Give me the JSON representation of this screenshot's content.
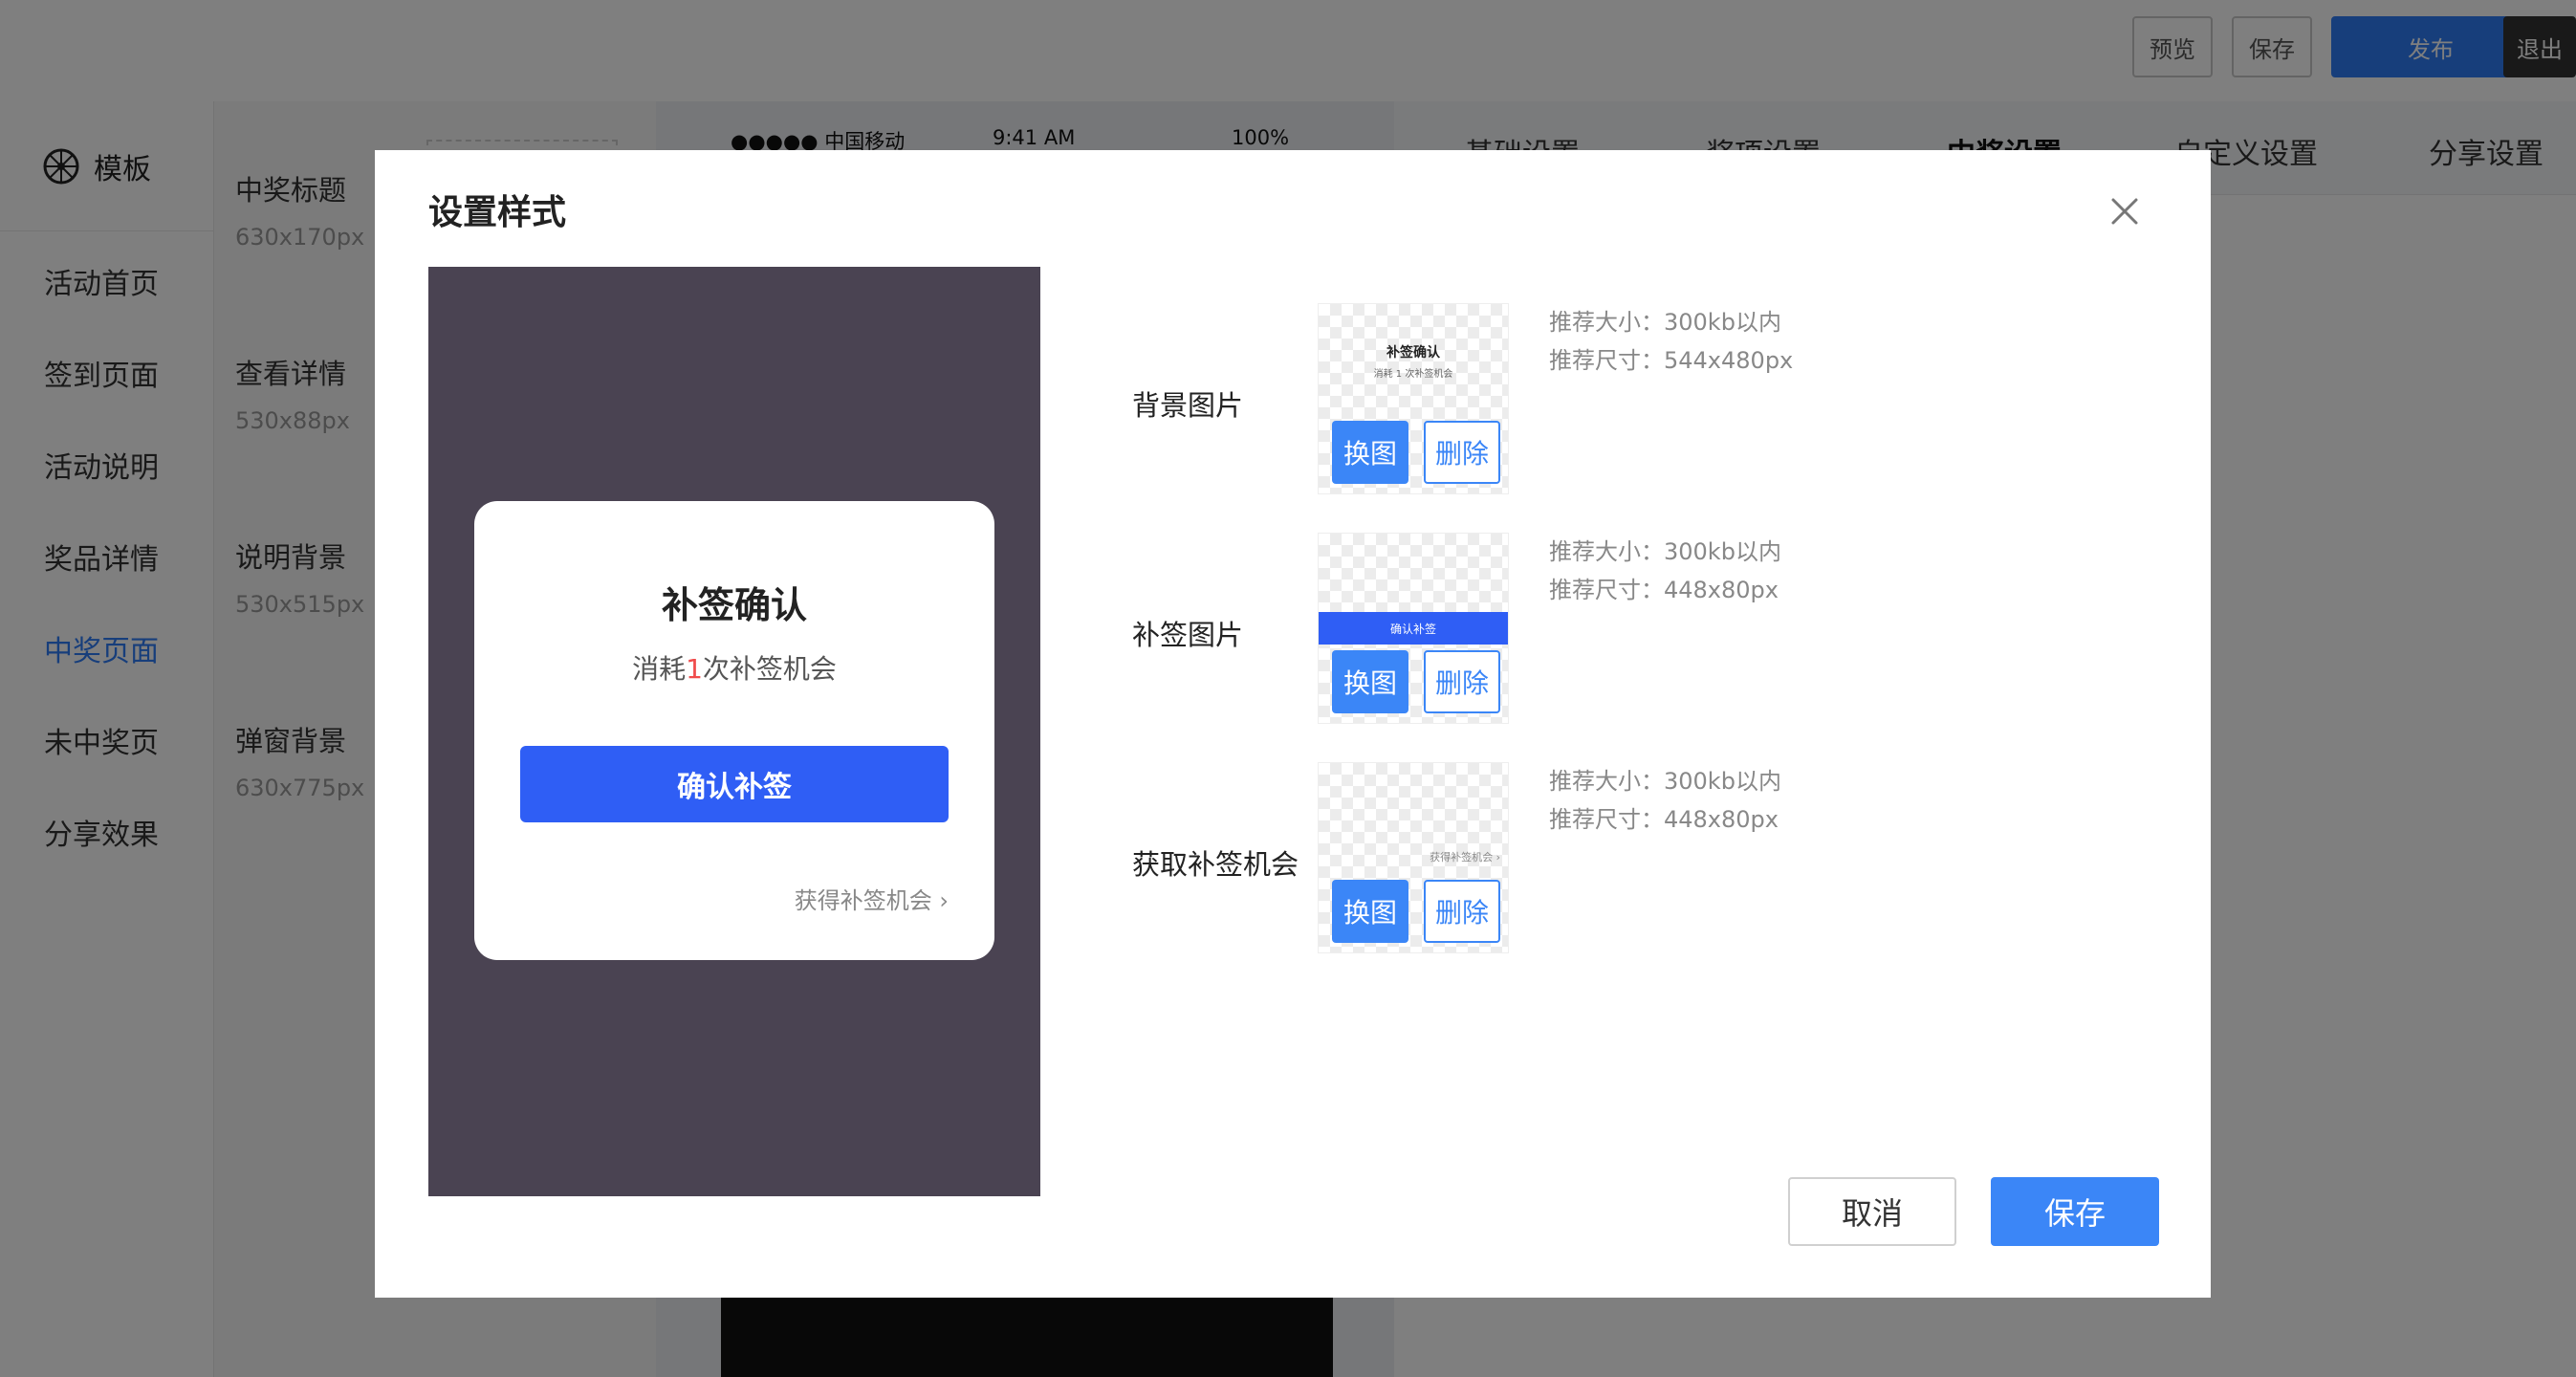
{
  "topbar": {
    "preview_label": "预览",
    "save_label": "保存",
    "publish_label": "发布",
    "exit_label": "退出"
  },
  "sidebar": {
    "header": "模板",
    "items": [
      {
        "label": "活动首页"
      },
      {
        "label": "签到页面"
      },
      {
        "label": "活动说明"
      },
      {
        "label": "奖品详情"
      },
      {
        "label": "中奖页面",
        "active": true
      },
      {
        "label": "未中奖页"
      },
      {
        "label": "分享效果"
      }
    ]
  },
  "asset_list": [
    {
      "title": "中奖标题",
      "size": "630x170px"
    },
    {
      "title": "查看详情",
      "size": "530x88px"
    },
    {
      "title": "说明背景",
      "size": "530x515px"
    },
    {
      "title": "弹窗背景",
      "size": "630x775px"
    }
  ],
  "phone": {
    "carrier": "●●●●● 中国移动",
    "time": "9:41 AM",
    "battery": "100%"
  },
  "settings_tabs": [
    {
      "label": "基础设置"
    },
    {
      "label": "奖项设置"
    },
    {
      "label": "中奖设置",
      "active": true
    },
    {
      "label": "自定义设置"
    },
    {
      "label": "分享设置"
    }
  ],
  "modal": {
    "title": "设置样式",
    "preview": {
      "title": "补签确认",
      "sub_prefix": "消耗",
      "sub_count": "1",
      "sub_suffix": "次补签机会",
      "button": "确认补签",
      "link": "获得补签机会"
    },
    "rows": [
      {
        "label": "背景图片",
        "change": "换图",
        "delete": "删除",
        "hint_size": "推荐大小：300kb以内",
        "hint_dim": "推荐尺寸：544x480px",
        "thumb_title": "补签确认",
        "thumb_sub": "消耗 1 次补签机会"
      },
      {
        "label": "补签图片",
        "change": "换图",
        "delete": "删除",
        "hint_size": "推荐大小：300kb以内",
        "hint_dim": "推荐尺寸：448x80px",
        "thumb_btn": "确认补签"
      },
      {
        "label": "获取补签机会",
        "change": "换图",
        "delete": "删除",
        "hint_size": "推荐大小：300kb以内",
        "hint_dim": "推荐尺寸：448x80px",
        "thumb_link": "获得补签机会 ›"
      }
    ],
    "cancel_label": "取消",
    "save_label": "保存"
  },
  "colors": {
    "accent": "#3b86f7",
    "preview_button": "#2f5ef5",
    "preview_bg": "#4a4352",
    "highlight": "#f04b4b"
  }
}
